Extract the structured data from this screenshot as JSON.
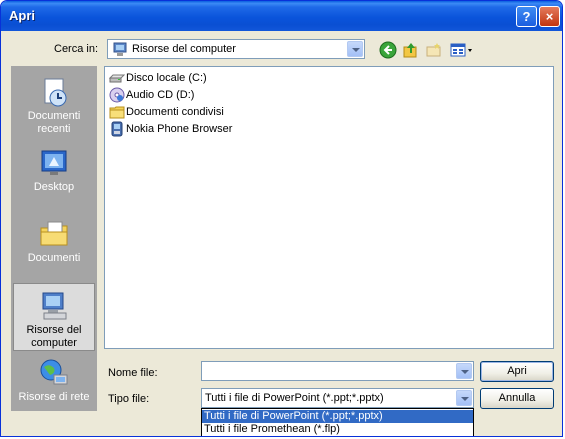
{
  "window": {
    "title": "Apri"
  },
  "titlebar": {
    "help_label": "?",
    "close_label": "×"
  },
  "lookin": {
    "label": "Cerca in:",
    "value": "Risorse del computer",
    "icon": "my-computer-icon"
  },
  "toolbar": {
    "icons": [
      "back-arrow-icon",
      "up-folder-icon",
      "new-folder-icon",
      "views-menu-icon"
    ]
  },
  "places": [
    {
      "label1": "Documenti",
      "label2": "recenti",
      "icon": "recent-documents-icon",
      "selected": false
    },
    {
      "label1": "Desktop",
      "label2": "",
      "icon": "desktop-icon",
      "selected": false
    },
    {
      "label1": "Documenti",
      "label2": "",
      "icon": "my-documents-icon",
      "selected": false
    },
    {
      "label1": "Risorse del",
      "label2": "computer",
      "icon": "my-computer-icon",
      "selected": true
    },
    {
      "label1": "Risorse di rete",
      "label2": "",
      "icon": "network-places-icon",
      "selected": false
    }
  ],
  "files": [
    {
      "name": "Disco locale (C:)",
      "icon": "hard-disk-icon"
    },
    {
      "name": "Audio CD (D:)",
      "icon": "cd-drive-icon"
    },
    {
      "name": "Documenti condivisi",
      "icon": "folder-icon"
    },
    {
      "name": "Nokia Phone Browser",
      "icon": "phone-browser-icon"
    }
  ],
  "filename": {
    "label": "Nome file:",
    "value": ""
  },
  "filetype": {
    "label": "Tipo file:",
    "value": "Tutti i file di PowerPoint (*.ppt;*.pptx)",
    "options": [
      "Tutti i file di PowerPoint (*.ppt;*.pptx)",
      "Tutti i file Promethean (*.flp)"
    ]
  },
  "buttons": {
    "open": "Apri",
    "cancel": "Annulla"
  },
  "colors": {
    "title_bar": "#0a54db",
    "dialog_bg": "#ece9d8",
    "highlight": "#316ac5"
  }
}
